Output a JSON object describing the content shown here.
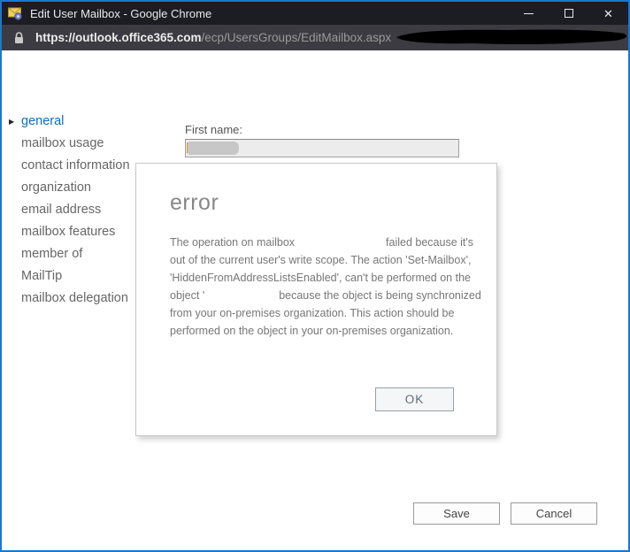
{
  "window": {
    "title": "Edit User Mailbox - Google Chrome",
    "controls": {
      "minimize": "minimize",
      "maximize": "maximize",
      "close": "✕"
    }
  },
  "address_bar": {
    "url_domain": "https://outlook.office365.com",
    "url_path": "/ecp/UsersGroups/EditMailbox.aspx",
    "redacted": true
  },
  "sidebar": {
    "items": [
      {
        "label": "general",
        "selected": true
      },
      {
        "label": "mailbox usage",
        "selected": false
      },
      {
        "label": "contact information",
        "selected": false
      },
      {
        "label": "organization",
        "selected": false
      },
      {
        "label": "email address",
        "selected": false
      },
      {
        "label": "mailbox features",
        "selected": false
      },
      {
        "label": "member of",
        "selected": false
      },
      {
        "label": "MailTip",
        "selected": false
      },
      {
        "label": "mailbox delegation",
        "selected": false
      }
    ]
  },
  "form": {
    "first_name_label": "First name:",
    "first_name_value": ""
  },
  "error_dialog": {
    "title": "error",
    "message_part1": "The operation on mailbox",
    "message_part2": "failed because it's out of the current user's write scope. The action 'Set-Mailbox', 'HiddenFromAddressListsEnabled', can't be performed on the object '",
    "message_part3": "because the object is being synchronized from your on-premises organization. This action should be performed on the object in your on-premises organization.",
    "ok_label": "OK"
  },
  "footer": {
    "save_label": "Save",
    "cancel_label": "Cancel"
  },
  "colors": {
    "window_border": "#1779d0",
    "titlebar_bg": "#1c1c23",
    "urlbar_bg": "#3b3b41",
    "nav_selected": "#0e6cc0",
    "nav_text": "#666666",
    "error_text": "#777777"
  }
}
